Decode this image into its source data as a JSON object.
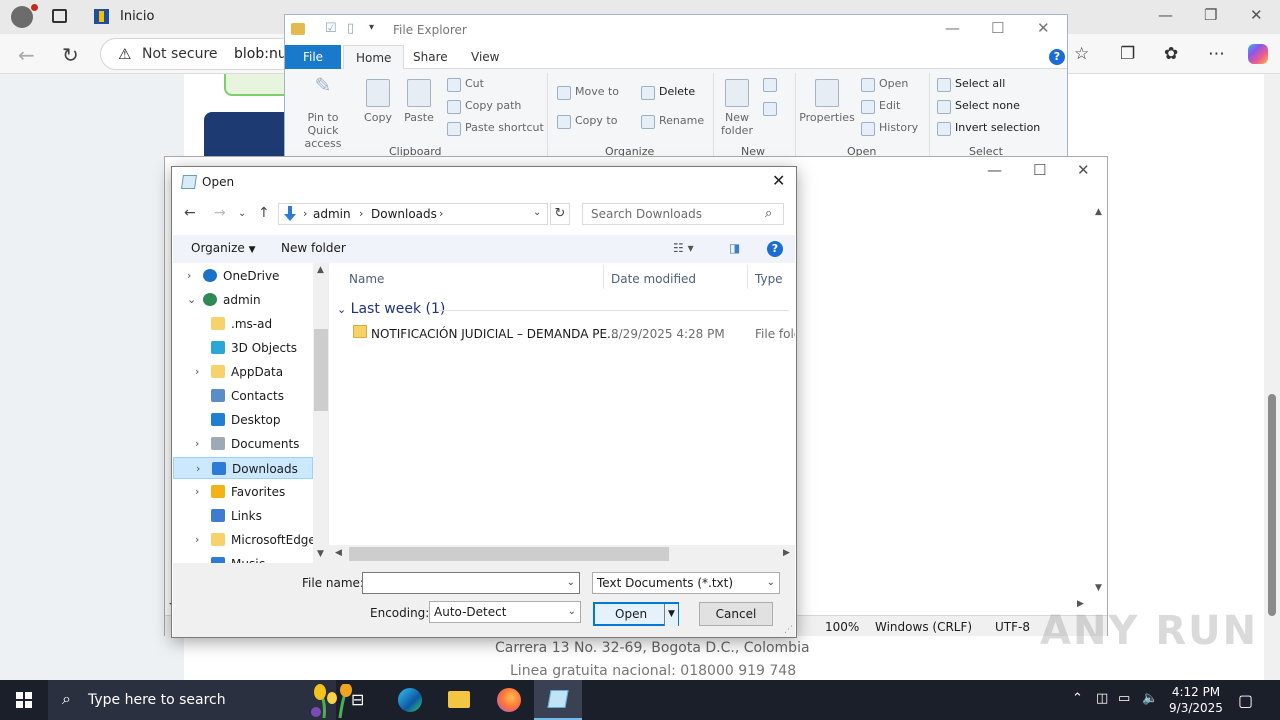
{
  "browser": {
    "tab_title": "Inicio",
    "address_security": "Not secure",
    "address_url": "blob:nu",
    "minimize_glyph": "—",
    "restore_glyph": "❐",
    "close_glyph": "✕"
  },
  "webpage": {
    "footer_address": "Carrera 13 No. 32-69, Bogota D.C., Colombia",
    "footer_phone": "Linea gratuita nacional: 018000 919 748"
  },
  "file_explorer": {
    "title": "File Explorer",
    "tabs": [
      "File",
      "Home",
      "Share",
      "View"
    ],
    "clipboard": {
      "pin": "Pin to Quick access",
      "copy": "Copy",
      "paste": "Paste",
      "cut": "Cut",
      "copy_path": "Copy path",
      "paste_shortcut": "Paste shortcut",
      "group": "Clipboard"
    },
    "organize": {
      "move_to": "Move to",
      "copy_to": "Copy to",
      "delete": "Delete",
      "rename": "Rename",
      "group": "Organize"
    },
    "new": {
      "new_folder": "New folder",
      "group": "New"
    },
    "open": {
      "properties": "Properties",
      "open": "Open",
      "edit": "Edit",
      "history": "History",
      "group": "Open"
    },
    "select": {
      "select_all": "Select all",
      "select_none": "Select none",
      "invert": "Invert selection",
      "group": "Select"
    }
  },
  "notepad": {
    "zoom": "100%",
    "line_ending": "Windows (CRLF)",
    "encoding": "UTF-8"
  },
  "dialog": {
    "title": "Open",
    "breadcrumb": [
      "admin",
      "Downloads"
    ],
    "search_placeholder": "Search Downloads",
    "organize": "Organize",
    "new_folder": "New folder",
    "tree": [
      {
        "label": "OneDrive",
        "icon": "cloud-icon",
        "expander": "›",
        "level": 0
      },
      {
        "label": "admin",
        "icon": "user-icon",
        "expander": "⌄",
        "level": 0
      },
      {
        "label": ".ms-ad",
        "icon": "folder-icon",
        "expander": "",
        "level": 1
      },
      {
        "label": "3D Objects",
        "icon": "cube-icon",
        "expander": "",
        "level": 1
      },
      {
        "label": "AppData",
        "icon": "folder-icon",
        "expander": "›",
        "level": 1
      },
      {
        "label": "Contacts",
        "icon": "contacts-icon",
        "expander": "",
        "level": 1
      },
      {
        "label": "Desktop",
        "icon": "desktop-icon",
        "expander": "",
        "level": 1
      },
      {
        "label": "Documents",
        "icon": "documents-icon",
        "expander": "›",
        "level": 1
      },
      {
        "label": "Downloads",
        "icon": "download-icon",
        "expander": "›",
        "level": 1,
        "selected": true
      },
      {
        "label": "Favorites",
        "icon": "star-icon",
        "expander": "›",
        "level": 1
      },
      {
        "label": "Links",
        "icon": "link-icon",
        "expander": "",
        "level": 1
      },
      {
        "label": "MicrosoftEdge",
        "icon": "folder-icon",
        "expander": "›",
        "level": 1
      },
      {
        "label": "Music",
        "icon": "music-icon",
        "expander": "",
        "level": 1
      }
    ],
    "columns": [
      "Name",
      "Date modified",
      "Type"
    ],
    "group_header": "Last week (1)",
    "rows": [
      {
        "name": "NOTIFICACIÓN JUDICIAL – DEMANDA PE...",
        "date": "8/29/2025 4:28 PM",
        "type": "File fold"
      }
    ],
    "file_name_label": "File name:",
    "file_name_value": "",
    "file_type": "Text Documents (*.txt)",
    "encoding_label": "Encoding:",
    "encoding_value": "Auto-Detect",
    "open_button": "Open",
    "cancel_button": "Cancel"
  },
  "taskbar": {
    "search_placeholder": "Type here to search",
    "time": "4:12 PM",
    "date": "9/3/2025"
  },
  "watermark": "ANY RUN",
  "colors": {
    "accent": "#0078d7",
    "file_tab": "#1979ca",
    "taskbar": "#1b1f29"
  }
}
